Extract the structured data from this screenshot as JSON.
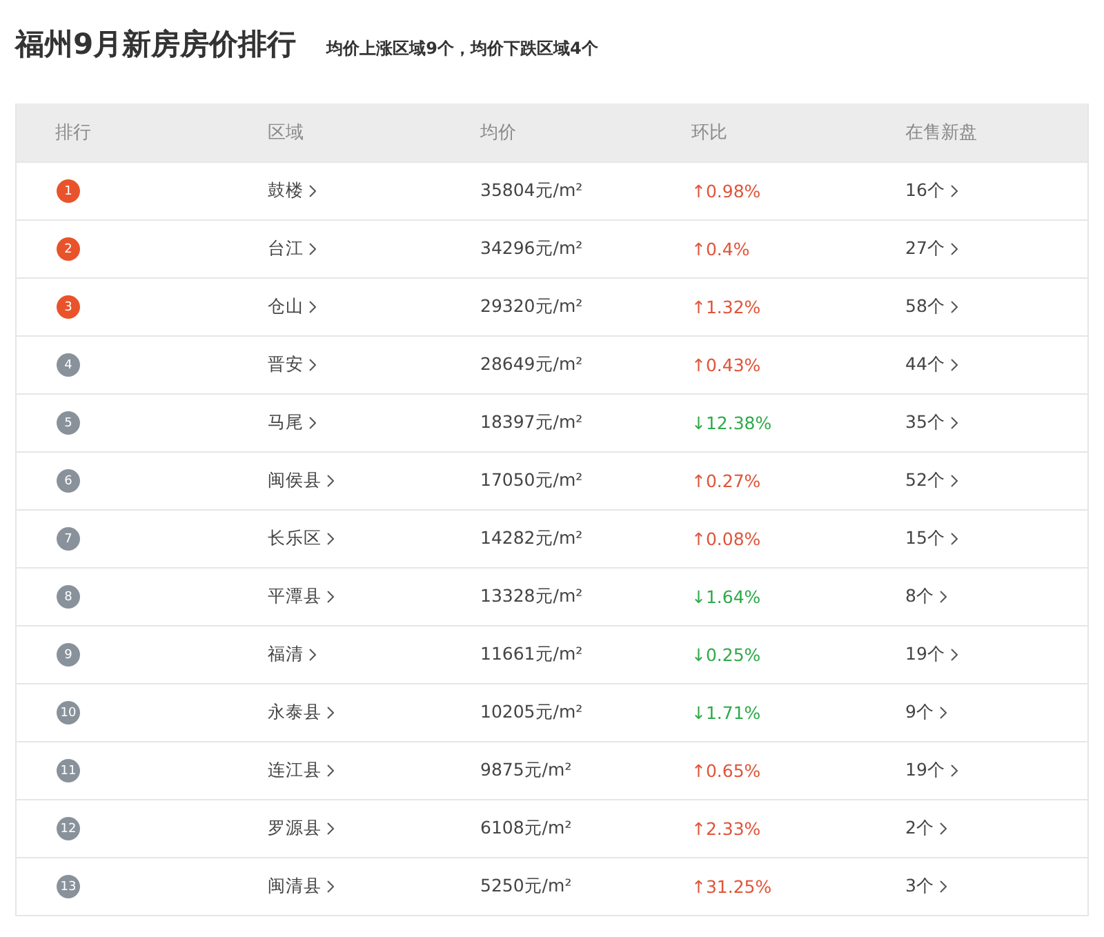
{
  "title": "福州9月新房房价排行",
  "summary": "均价上涨区域9个，均价下跌区域4个",
  "table": {
    "columns": [
      "排行",
      "区域",
      "均价",
      "环比",
      "在售新盘"
    ],
    "rows": [
      {
        "rank": "1",
        "color": "#e9532b",
        "region": "鼓楼",
        "price": "35804元/m²",
        "change": "↑0.98%",
        "kind": "up",
        "count": "16个"
      },
      {
        "rank": "2",
        "color": "#e9532b",
        "region": "台江",
        "price": "34296元/m²",
        "change": "↑0.4%",
        "kind": "up",
        "count": "27个"
      },
      {
        "rank": "3",
        "color": "#e9532b",
        "region": "仓山",
        "price": "29320元/m²",
        "change": "↑1.32%",
        "kind": "up",
        "count": "58个"
      },
      {
        "rank": "4",
        "color": "#89929b",
        "region": "晋安",
        "price": "28649元/m²",
        "change": "↑0.43%",
        "kind": "up",
        "count": "44个"
      },
      {
        "rank": "5",
        "color": "#89929b",
        "region": "马尾",
        "price": "18397元/m²",
        "change": "↓12.38%",
        "kind": "down",
        "count": "35个"
      },
      {
        "rank": "6",
        "color": "#89929b",
        "region": "闽侯县",
        "price": "17050元/m²",
        "change": "↑0.27%",
        "kind": "up",
        "count": "52个"
      },
      {
        "rank": "7",
        "color": "#89929b",
        "region": "长乐区",
        "price": "14282元/m²",
        "change": "↑0.08%",
        "kind": "up",
        "count": "15个"
      },
      {
        "rank": "8",
        "color": "#89929b",
        "region": "平潭县",
        "price": "13328元/m²",
        "change": "↓1.64%",
        "kind": "down",
        "count": "8个"
      },
      {
        "rank": "9",
        "color": "#89929b",
        "region": "福清",
        "price": "11661元/m²",
        "change": "↓0.25%",
        "kind": "down",
        "count": "19个"
      },
      {
        "rank": "10",
        "color": "#89929b",
        "region": "永泰县",
        "price": "10205元/m²",
        "change": "↓1.71%",
        "kind": "down",
        "count": "9个"
      },
      {
        "rank": "11",
        "color": "#89929b",
        "region": "连江县",
        "price": "9875元/m²",
        "change": "↑0.65%",
        "kind": "up",
        "count": "19个"
      },
      {
        "rank": "12",
        "color": "#89929b",
        "region": "罗源县",
        "price": "6108元/m²",
        "change": "↑2.33%",
        "kind": "up",
        "count": "2个"
      },
      {
        "rank": "13",
        "color": "#89929b",
        "region": "闽清县",
        "price": "5250元/m²",
        "change": "↑31.25%",
        "kind": "up",
        "count": "3个"
      }
    ]
  }
}
